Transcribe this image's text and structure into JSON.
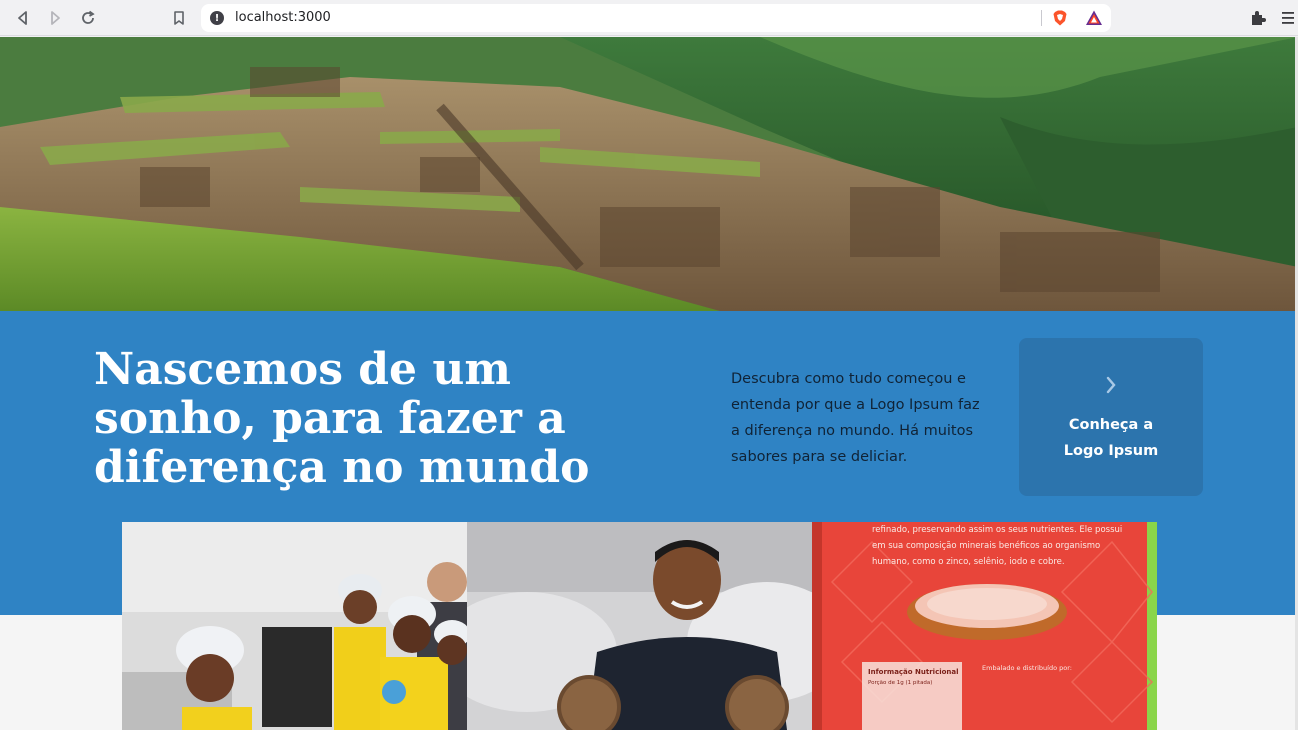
{
  "browser": {
    "url": "localhost:3000"
  },
  "hero": {
    "headline": "Nascemos de um sonho, para fazer a diferença no mundo",
    "description": "Descubra como tudo começou e entenda por que a Logo Ipsum faz a diferença no mundo. Há muitos sabores para se deliciar.",
    "cta_label": "Conheça a Logo Ipsum"
  },
  "product_photo": {
    "package_text": "refinado, preservando assim os seus nutrientes. Ele possui em sua composição minerais benéficos ao organismo humano, como o zinco, selênio, iodo e cobre.",
    "nutrition_title": "Informação Nutricional",
    "nutrition_portion": "Porção de 1g (1 pitada)",
    "packer_title": "Embalado e distribuído por:"
  },
  "colors": {
    "brand_blue": "#2f83c4",
    "card_blue": "#2c74ad",
    "headline_white": "#ffffff",
    "body_text": "#102336"
  }
}
